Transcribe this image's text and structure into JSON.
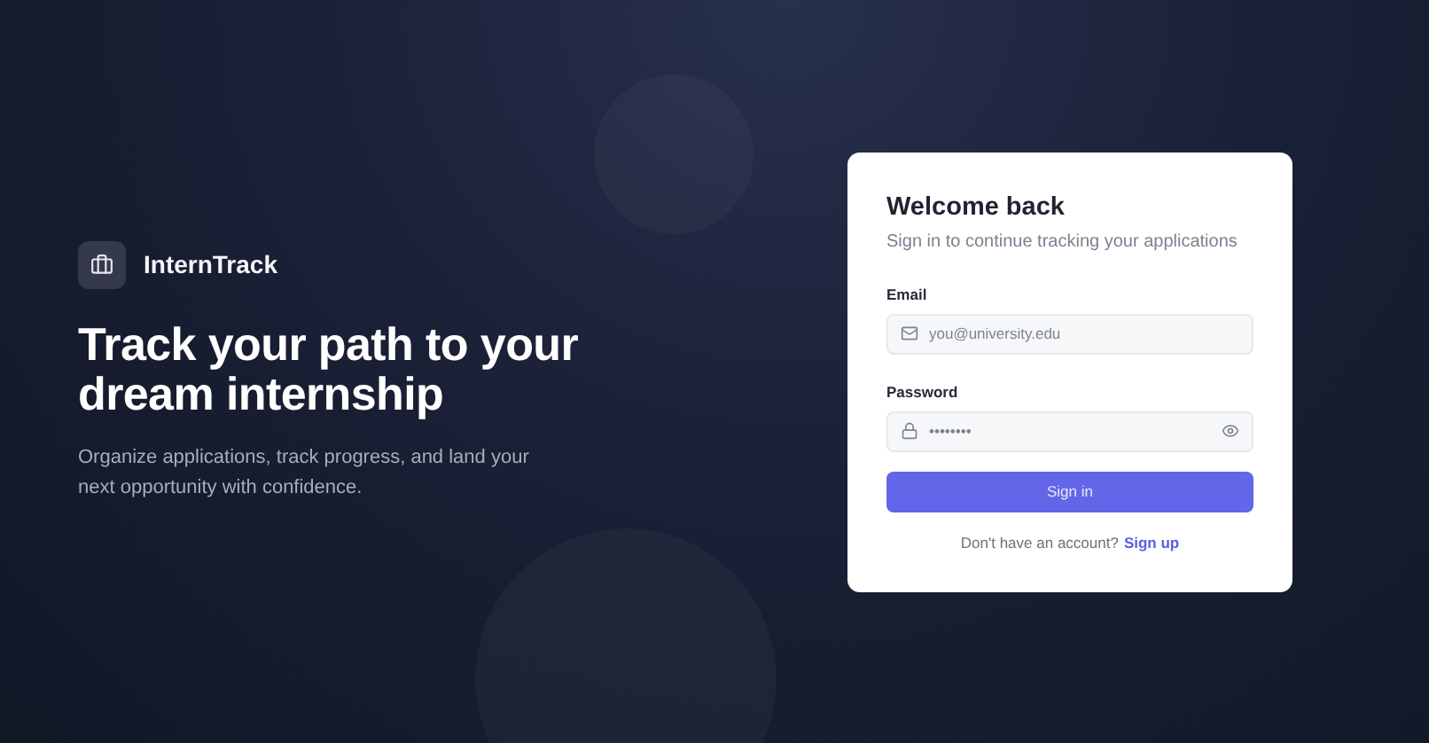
{
  "brand": {
    "name": "InternTrack"
  },
  "hero": {
    "title": "Track your path to your dream internship",
    "subtitle": "Organize applications, track progress, and land your next opportunity with confidence."
  },
  "card": {
    "title": "Welcome back",
    "subtitle": "Sign in to continue tracking your applications",
    "fields": [
      {
        "kind": "email",
        "label": "Email",
        "placeholder": "you@university.edu"
      },
      {
        "kind": "password",
        "label": "Password",
        "placeholder": "••••••••"
      }
    ],
    "submit": "Sign in",
    "footer_text": "Don't have an account?",
    "footer_link": "Sign up"
  }
}
